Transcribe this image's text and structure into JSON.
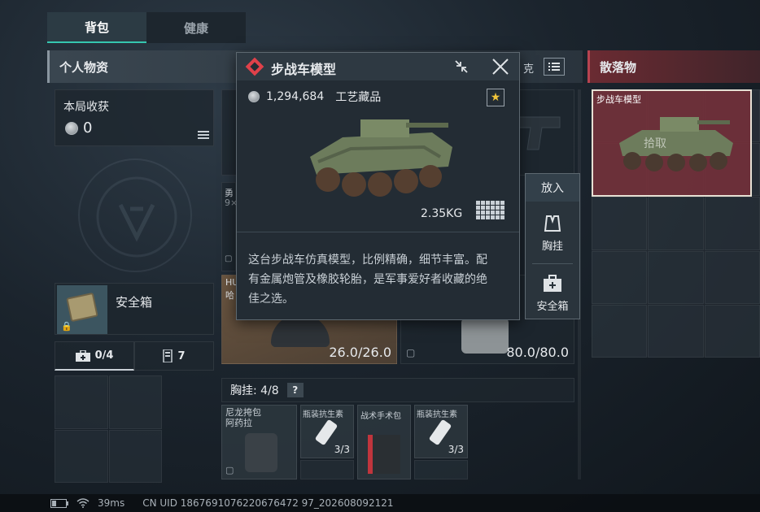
{
  "tabs": [
    {
      "label": "背包",
      "active": true
    },
    {
      "label": "健康",
      "active": false
    }
  ],
  "personal_section": {
    "title": "个人物资"
  },
  "scatter_section": {
    "title": "散落物"
  },
  "harvest": {
    "label": "本局收获",
    "value": "0"
  },
  "safe_box": {
    "label": "安全箱"
  },
  "capacity": {
    "medkit_count": "0/4",
    "ammo_count": "7"
  },
  "chest_rig": {
    "label": "胸挂: 4/8",
    "help": "?"
  },
  "durability": {
    "helmet": "26.0/26.0",
    "armor": "80.0/80.0"
  },
  "hidden_labels": {
    "left_top": "勇",
    "left_mid": "9×",
    "helmet_label": "HU",
    "helmet_sub": "哈"
  },
  "rig_items": [
    {
      "name": "尼龙挎包\n阿药拉",
      "count": ""
    },
    {
      "name": "瓶装抗生素",
      "count": "3/3"
    },
    {
      "name": "战术手术包",
      "count": ""
    },
    {
      "name": "瓶装抗生素",
      "count": "3/3"
    }
  ],
  "tooltip": {
    "title": "步战车模型",
    "price": "1,294,684",
    "category": "工艺藏品",
    "weight": "2.35KG",
    "description": "这台步战车仿真模型，比例精确，细节丰富。配有金属炮管及橡胶轮胎，是军事爱好者收藏的绝佳之选。",
    "header_fragment": "克"
  },
  "place_menu": {
    "title": "放入",
    "options": [
      {
        "label": "胸挂",
        "icon": "vest-icon"
      },
      {
        "label": "安全箱",
        "icon": "safe-box-icon"
      }
    ]
  },
  "scatter_item": {
    "name": "步战车模型",
    "action": "拾取"
  },
  "status_bar": {
    "ping": "39ms",
    "uid": "CN UID 1867691076220676472 97_202608092121"
  },
  "colors": {
    "accent_teal": "#35c7b0",
    "scatter_red": "#b74350",
    "tooltip_icon_red": "#e0414a",
    "star_yellow": "#f0c43a"
  }
}
